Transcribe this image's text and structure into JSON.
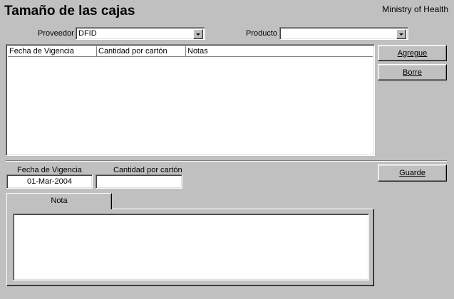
{
  "header": {
    "title": "Tamaño de las cajas",
    "organization": "Ministry of Health"
  },
  "filters": {
    "supplier_label": "Proveedor",
    "supplier_value": "DFID",
    "product_label": "Producto",
    "product_value": ""
  },
  "grid": {
    "columns": [
      "Fecha de Vigencia",
      "Cantidad por cartón",
      "Notas"
    ],
    "rows": []
  },
  "buttons": {
    "add_label": "Agregue",
    "delete_label": "Borre",
    "save_label": "Guarde"
  },
  "form": {
    "effective_date_label": "Fecha de Vigencia",
    "effective_date_value": "01-Mar-2004",
    "qty_label": "Cantidad por cartón",
    "qty_value": ""
  },
  "tabs": {
    "note_label": "Nota"
  },
  "note": {
    "value": ""
  }
}
